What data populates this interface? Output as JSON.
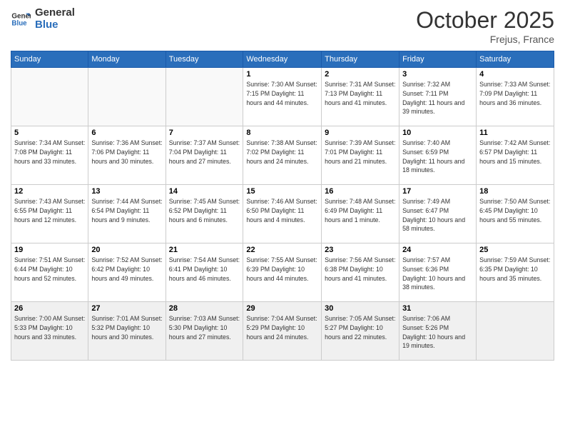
{
  "header": {
    "logo_line1": "General",
    "logo_line2": "Blue",
    "month": "October 2025",
    "location": "Frejus, France"
  },
  "weekdays": [
    "Sunday",
    "Monday",
    "Tuesday",
    "Wednesday",
    "Thursday",
    "Friday",
    "Saturday"
  ],
  "weeks": [
    [
      {
        "num": "",
        "info": ""
      },
      {
        "num": "",
        "info": ""
      },
      {
        "num": "",
        "info": ""
      },
      {
        "num": "1",
        "info": "Sunrise: 7:30 AM\nSunset: 7:15 PM\nDaylight: 11 hours\nand 44 minutes."
      },
      {
        "num": "2",
        "info": "Sunrise: 7:31 AM\nSunset: 7:13 PM\nDaylight: 11 hours\nand 41 minutes."
      },
      {
        "num": "3",
        "info": "Sunrise: 7:32 AM\nSunset: 7:11 PM\nDaylight: 11 hours\nand 39 minutes."
      },
      {
        "num": "4",
        "info": "Sunrise: 7:33 AM\nSunset: 7:09 PM\nDaylight: 11 hours\nand 36 minutes."
      }
    ],
    [
      {
        "num": "5",
        "info": "Sunrise: 7:34 AM\nSunset: 7:08 PM\nDaylight: 11 hours\nand 33 minutes."
      },
      {
        "num": "6",
        "info": "Sunrise: 7:36 AM\nSunset: 7:06 PM\nDaylight: 11 hours\nand 30 minutes."
      },
      {
        "num": "7",
        "info": "Sunrise: 7:37 AM\nSunset: 7:04 PM\nDaylight: 11 hours\nand 27 minutes."
      },
      {
        "num": "8",
        "info": "Sunrise: 7:38 AM\nSunset: 7:02 PM\nDaylight: 11 hours\nand 24 minutes."
      },
      {
        "num": "9",
        "info": "Sunrise: 7:39 AM\nSunset: 7:01 PM\nDaylight: 11 hours\nand 21 minutes."
      },
      {
        "num": "10",
        "info": "Sunrise: 7:40 AM\nSunset: 6:59 PM\nDaylight: 11 hours\nand 18 minutes."
      },
      {
        "num": "11",
        "info": "Sunrise: 7:42 AM\nSunset: 6:57 PM\nDaylight: 11 hours\nand 15 minutes."
      }
    ],
    [
      {
        "num": "12",
        "info": "Sunrise: 7:43 AM\nSunset: 6:55 PM\nDaylight: 11 hours\nand 12 minutes."
      },
      {
        "num": "13",
        "info": "Sunrise: 7:44 AM\nSunset: 6:54 PM\nDaylight: 11 hours\nand 9 minutes."
      },
      {
        "num": "14",
        "info": "Sunrise: 7:45 AM\nSunset: 6:52 PM\nDaylight: 11 hours\nand 6 minutes."
      },
      {
        "num": "15",
        "info": "Sunrise: 7:46 AM\nSunset: 6:50 PM\nDaylight: 11 hours\nand 4 minutes."
      },
      {
        "num": "16",
        "info": "Sunrise: 7:48 AM\nSunset: 6:49 PM\nDaylight: 11 hours\nand 1 minute."
      },
      {
        "num": "17",
        "info": "Sunrise: 7:49 AM\nSunset: 6:47 PM\nDaylight: 10 hours\nand 58 minutes."
      },
      {
        "num": "18",
        "info": "Sunrise: 7:50 AM\nSunset: 6:45 PM\nDaylight: 10 hours\nand 55 minutes."
      }
    ],
    [
      {
        "num": "19",
        "info": "Sunrise: 7:51 AM\nSunset: 6:44 PM\nDaylight: 10 hours\nand 52 minutes."
      },
      {
        "num": "20",
        "info": "Sunrise: 7:52 AM\nSunset: 6:42 PM\nDaylight: 10 hours\nand 49 minutes."
      },
      {
        "num": "21",
        "info": "Sunrise: 7:54 AM\nSunset: 6:41 PM\nDaylight: 10 hours\nand 46 minutes."
      },
      {
        "num": "22",
        "info": "Sunrise: 7:55 AM\nSunset: 6:39 PM\nDaylight: 10 hours\nand 44 minutes."
      },
      {
        "num": "23",
        "info": "Sunrise: 7:56 AM\nSunset: 6:38 PM\nDaylight: 10 hours\nand 41 minutes."
      },
      {
        "num": "24",
        "info": "Sunrise: 7:57 AM\nSunset: 6:36 PM\nDaylight: 10 hours\nand 38 minutes."
      },
      {
        "num": "25",
        "info": "Sunrise: 7:59 AM\nSunset: 6:35 PM\nDaylight: 10 hours\nand 35 minutes."
      }
    ],
    [
      {
        "num": "26",
        "info": "Sunrise: 7:00 AM\nSunset: 5:33 PM\nDaylight: 10 hours\nand 33 minutes."
      },
      {
        "num": "27",
        "info": "Sunrise: 7:01 AM\nSunset: 5:32 PM\nDaylight: 10 hours\nand 30 minutes."
      },
      {
        "num": "28",
        "info": "Sunrise: 7:03 AM\nSunset: 5:30 PM\nDaylight: 10 hours\nand 27 minutes."
      },
      {
        "num": "29",
        "info": "Sunrise: 7:04 AM\nSunset: 5:29 PM\nDaylight: 10 hours\nand 24 minutes."
      },
      {
        "num": "30",
        "info": "Sunrise: 7:05 AM\nSunset: 5:27 PM\nDaylight: 10 hours\nand 22 minutes."
      },
      {
        "num": "31",
        "info": "Sunrise: 7:06 AM\nSunset: 5:26 PM\nDaylight: 10 hours\nand 19 minutes."
      },
      {
        "num": "",
        "info": ""
      }
    ]
  ]
}
